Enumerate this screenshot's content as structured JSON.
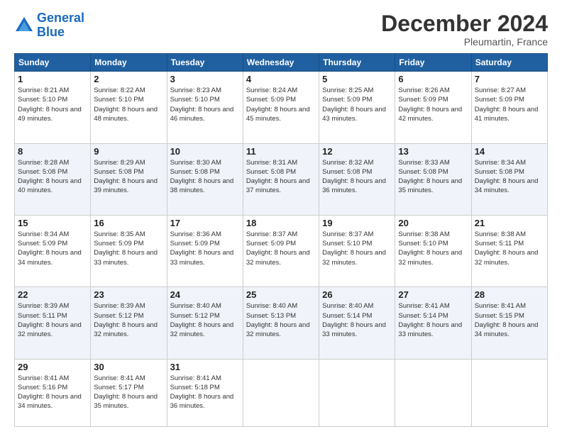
{
  "logo": {
    "line1": "General",
    "line2": "Blue"
  },
  "header": {
    "month": "December 2024",
    "location": "Pleumartin, France"
  },
  "days_of_week": [
    "Sunday",
    "Monday",
    "Tuesday",
    "Wednesday",
    "Thursday",
    "Friday",
    "Saturday"
  ],
  "weeks": [
    [
      {
        "day": "1",
        "sunrise": "8:21 AM",
        "sunset": "5:10 PM",
        "daylight": "8 hours and 49 minutes."
      },
      {
        "day": "2",
        "sunrise": "8:22 AM",
        "sunset": "5:10 PM",
        "daylight": "8 hours and 48 minutes."
      },
      {
        "day": "3",
        "sunrise": "8:23 AM",
        "sunset": "5:10 PM",
        "daylight": "8 hours and 46 minutes."
      },
      {
        "day": "4",
        "sunrise": "8:24 AM",
        "sunset": "5:09 PM",
        "daylight": "8 hours and 45 minutes."
      },
      {
        "day": "5",
        "sunrise": "8:25 AM",
        "sunset": "5:09 PM",
        "daylight": "8 hours and 43 minutes."
      },
      {
        "day": "6",
        "sunrise": "8:26 AM",
        "sunset": "5:09 PM",
        "daylight": "8 hours and 42 minutes."
      },
      {
        "day": "7",
        "sunrise": "8:27 AM",
        "sunset": "5:09 PM",
        "daylight": "8 hours and 41 minutes."
      }
    ],
    [
      {
        "day": "8",
        "sunrise": "8:28 AM",
        "sunset": "5:08 PM",
        "daylight": "8 hours and 40 minutes."
      },
      {
        "day": "9",
        "sunrise": "8:29 AM",
        "sunset": "5:08 PM",
        "daylight": "8 hours and 39 minutes."
      },
      {
        "day": "10",
        "sunrise": "8:30 AM",
        "sunset": "5:08 PM",
        "daylight": "8 hours and 38 minutes."
      },
      {
        "day": "11",
        "sunrise": "8:31 AM",
        "sunset": "5:08 PM",
        "daylight": "8 hours and 37 minutes."
      },
      {
        "day": "12",
        "sunrise": "8:32 AM",
        "sunset": "5:08 PM",
        "daylight": "8 hours and 36 minutes."
      },
      {
        "day": "13",
        "sunrise": "8:33 AM",
        "sunset": "5:08 PM",
        "daylight": "8 hours and 35 minutes."
      },
      {
        "day": "14",
        "sunrise": "8:34 AM",
        "sunset": "5:08 PM",
        "daylight": "8 hours and 34 minutes."
      }
    ],
    [
      {
        "day": "15",
        "sunrise": "8:34 AM",
        "sunset": "5:09 PM",
        "daylight": "8 hours and 34 minutes."
      },
      {
        "day": "16",
        "sunrise": "8:35 AM",
        "sunset": "5:09 PM",
        "daylight": "8 hours and 33 minutes."
      },
      {
        "day": "17",
        "sunrise": "8:36 AM",
        "sunset": "5:09 PM",
        "daylight": "8 hours and 33 minutes."
      },
      {
        "day": "18",
        "sunrise": "8:37 AM",
        "sunset": "5:09 PM",
        "daylight": "8 hours and 32 minutes."
      },
      {
        "day": "19",
        "sunrise": "8:37 AM",
        "sunset": "5:10 PM",
        "daylight": "8 hours and 32 minutes."
      },
      {
        "day": "20",
        "sunrise": "8:38 AM",
        "sunset": "5:10 PM",
        "daylight": "8 hours and 32 minutes."
      },
      {
        "day": "21",
        "sunrise": "8:38 AM",
        "sunset": "5:11 PM",
        "daylight": "8 hours and 32 minutes."
      }
    ],
    [
      {
        "day": "22",
        "sunrise": "8:39 AM",
        "sunset": "5:11 PM",
        "daylight": "8 hours and 32 minutes."
      },
      {
        "day": "23",
        "sunrise": "8:39 AM",
        "sunset": "5:12 PM",
        "daylight": "8 hours and 32 minutes."
      },
      {
        "day": "24",
        "sunrise": "8:40 AM",
        "sunset": "5:12 PM",
        "daylight": "8 hours and 32 minutes."
      },
      {
        "day": "25",
        "sunrise": "8:40 AM",
        "sunset": "5:13 PM",
        "daylight": "8 hours and 32 minutes."
      },
      {
        "day": "26",
        "sunrise": "8:40 AM",
        "sunset": "5:14 PM",
        "daylight": "8 hours and 33 minutes."
      },
      {
        "day": "27",
        "sunrise": "8:41 AM",
        "sunset": "5:14 PM",
        "daylight": "8 hours and 33 minutes."
      },
      {
        "day": "28",
        "sunrise": "8:41 AM",
        "sunset": "5:15 PM",
        "daylight": "8 hours and 34 minutes."
      }
    ],
    [
      {
        "day": "29",
        "sunrise": "8:41 AM",
        "sunset": "5:16 PM",
        "daylight": "8 hours and 34 minutes."
      },
      {
        "day": "30",
        "sunrise": "8:41 AM",
        "sunset": "5:17 PM",
        "daylight": "8 hours and 35 minutes."
      },
      {
        "day": "31",
        "sunrise": "8:41 AM",
        "sunset": "5:18 PM",
        "daylight": "8 hours and 36 minutes."
      },
      null,
      null,
      null,
      null
    ]
  ]
}
